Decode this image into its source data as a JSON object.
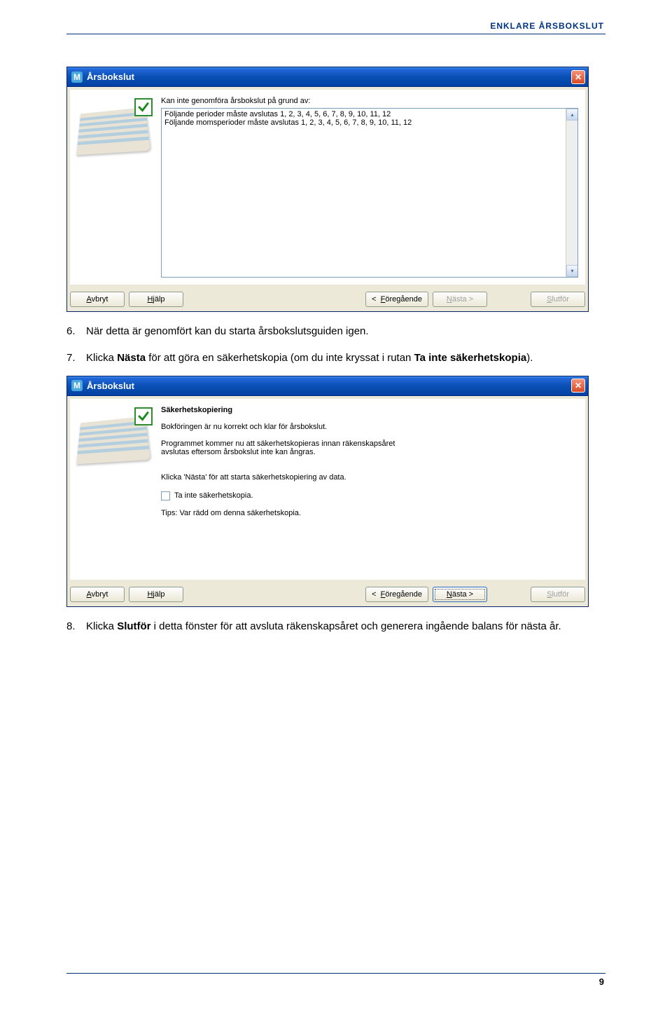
{
  "header": "ENKLARE ÅRSBOKSLUT",
  "dialog1": {
    "title": "Årsbokslut",
    "prompt": "Kan inte genomföra årsbokslut på grund av:",
    "lines": [
      "Följande perioder måste avslutas 1, 2, 3, 4, 5, 6, 7, 8, 9, 10, 11, 12",
      "Följande momsperioder måste avslutas 1, 2, 3, 4, 5, 6, 7, 8, 9, 10, 11, 12"
    ],
    "buttons": {
      "cancel": "Avbryt",
      "help": "Hjälp",
      "prev": "Föregående",
      "next": "Nästa >",
      "finish": "Slutför"
    }
  },
  "step6": {
    "num": "6.",
    "text": "När detta är genomfört kan du starta årsbokslutsguiden igen."
  },
  "step7": {
    "num": "7.",
    "pre": "Klicka ",
    "b1": "Nästa",
    "mid": " för att göra en säkerhetskopia (om du inte kryssat i rutan ",
    "b2": "Ta inte säkerhetskopia",
    "post": ")."
  },
  "dialog2": {
    "title": "Årsbokslut",
    "heading": "Säkerhetskopiering",
    "l1": "Bokföringen är nu korrekt och klar för årsbokslut.",
    "l2a": "Programmet kommer nu att säkerhetskopieras innan räkenskapsåret",
    "l2b": "avslutas eftersom årsbokslut inte kan ångras.",
    "l3": "Klicka 'Nästa' för att starta säkerhetskopiering av data.",
    "chk_label": "Ta inte säkerhetskopia.",
    "tip": "Tips: Var rädd om denna säkerhetskopia.",
    "buttons": {
      "cancel": "Avbryt",
      "help": "Hjälp",
      "prev": "Föregående",
      "next": "Nästa >",
      "finish": "Slutför"
    }
  },
  "step8": {
    "num": "8.",
    "pre": "Klicka ",
    "b1": "Slutför",
    "post": " i detta fönster för att avsluta räkenskapsåret och generera ingående balans för nästa år."
  },
  "page_number": "9"
}
